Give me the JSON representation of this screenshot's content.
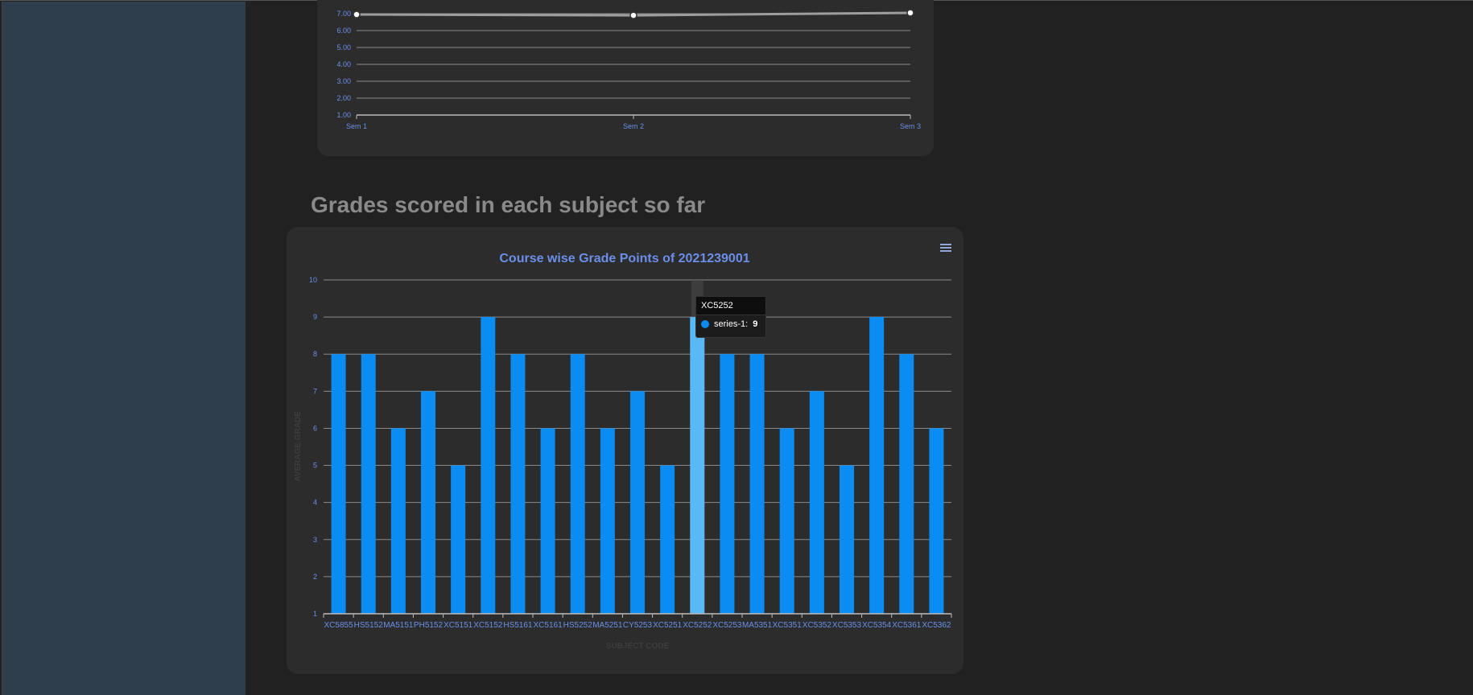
{
  "heading": "Grades scored in each subject so far",
  "colors": {
    "bar": "#0a8cf2",
    "bar_hover": "#5ab8f6",
    "label": "#6b8fe8",
    "grid": "#8a8a8a",
    "line": "#9e9e9e"
  },
  "menu_icon": "hamburger-menu-icon",
  "tooltip": {
    "category": "XC5252",
    "series_label": "series-1:",
    "value": "9"
  },
  "chart_data": [
    {
      "type": "line",
      "x": [
        "Sem 1",
        "Sem 2",
        "Sem 3"
      ],
      "series": [
        {
          "values": [
            6.95,
            6.9,
            7.05
          ]
        }
      ],
      "ylim": [
        1.0,
        7.0
      ],
      "yticks": [
        "1.00",
        "2.00",
        "3.00",
        "4.00",
        "5.00",
        "6.00",
        "7.00"
      ],
      "grid": true
    },
    {
      "type": "bar",
      "title": "Course wise Grade Points of 2021239001",
      "xlabel": "SUBJECT CODE",
      "ylabel": "AVERAGE GRADE",
      "categories": [
        "XC5855",
        "HS5152",
        "MA5151",
        "PH5152",
        "XC5151",
        "XC5152",
        "HS5161",
        "XC5161",
        "HS5252",
        "MA5251",
        "CY5253",
        "XC5251",
        "XC5252",
        "XC5253",
        "MA5351",
        "XC5351",
        "XC5352",
        "XC5353",
        "XC5354",
        "XC5361",
        "XC5362"
      ],
      "series": [
        {
          "name": "series-1",
          "values": [
            8,
            8,
            6,
            7,
            5,
            9,
            8,
            6,
            8,
            6,
            7,
            5,
            9,
            8,
            8,
            6,
            7,
            5,
            9,
            8,
            6
          ]
        }
      ],
      "ylim": [
        1,
        10
      ],
      "yticks": [
        "1",
        "2",
        "3",
        "4",
        "5",
        "6",
        "7",
        "8",
        "9",
        "10"
      ],
      "grid": true,
      "highlight_index": 12
    }
  ]
}
